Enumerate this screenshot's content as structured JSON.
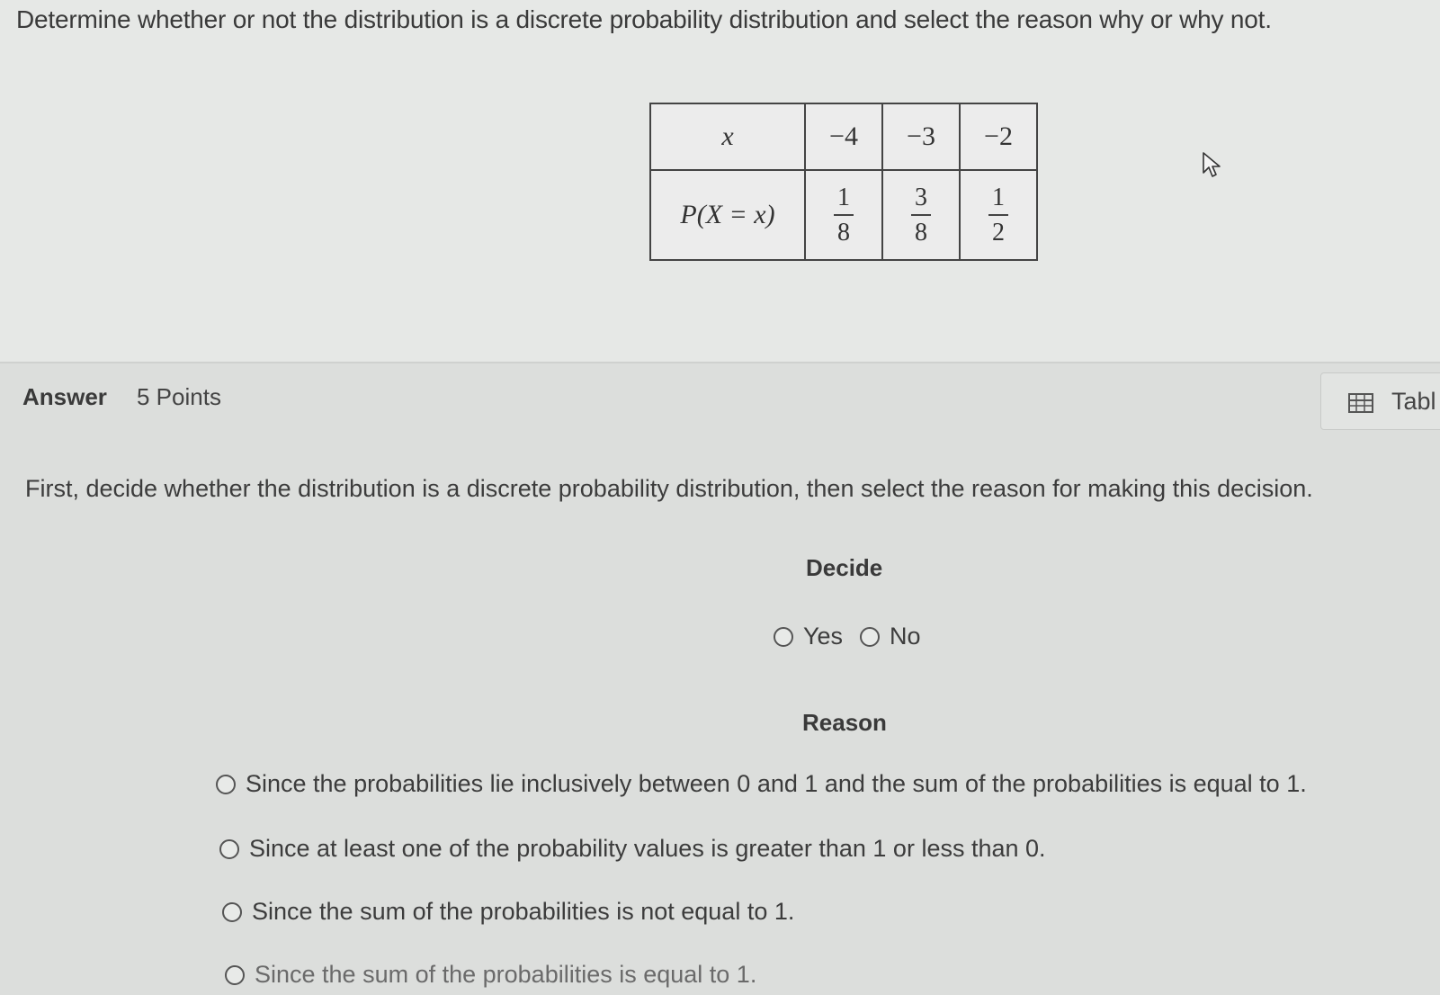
{
  "question": {
    "text": "Determine whether or not the distribution is a discrete probability distribution and select the reason why or why not."
  },
  "table": {
    "x_label": "x",
    "p_label": "P(X = x)",
    "x_values": [
      "−4",
      "−3",
      "−2"
    ],
    "probabilities": [
      {
        "num": "1",
        "den": "8"
      },
      {
        "num": "3",
        "den": "8"
      },
      {
        "num": "1",
        "den": "2"
      }
    ]
  },
  "answer": {
    "label": "Answer",
    "points": "5 Points",
    "table_button": "Tabl",
    "instructions": "First, decide whether the distribution is a discrete probability distribution, then select the reason for making this decision.",
    "decide_heading": "Decide",
    "decide_options": [
      "Yes",
      "No"
    ],
    "reason_heading": "Reason",
    "reasons": [
      "Since the probabilities lie inclusively between 0 and 1 and the sum of the probabilities is equal to 1.",
      "Since at least one of the probability values is greater than 1 or less than 0.",
      "Since the sum of the probabilities is not equal to 1.",
      "Since the sum of the probabilities is equal to 1."
    ]
  },
  "icons": {
    "table_icon": "table-grid-icon",
    "cursor": "mouse-pointer-icon"
  }
}
